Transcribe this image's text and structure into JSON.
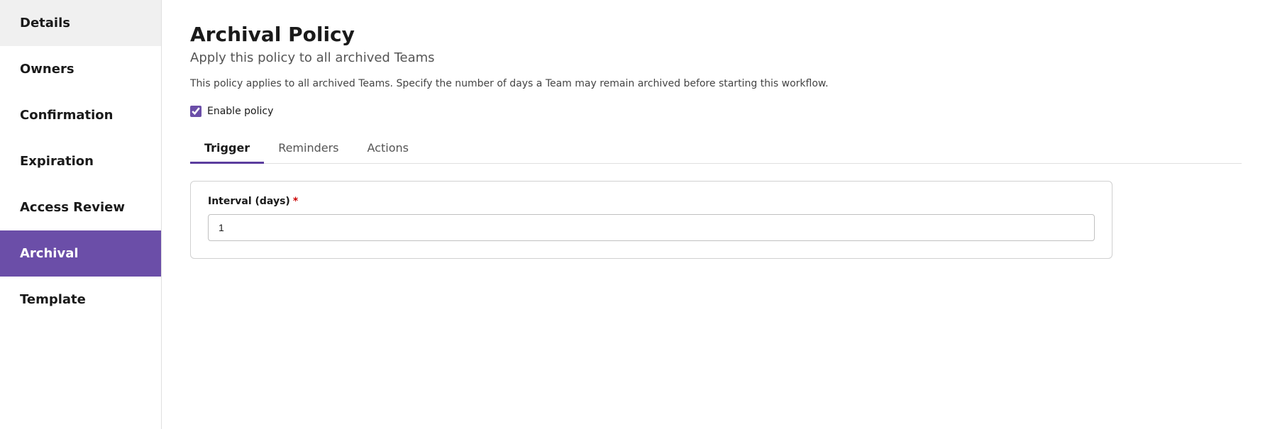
{
  "sidebar": {
    "items": [
      {
        "id": "details",
        "label": "Details",
        "active": false
      },
      {
        "id": "owners",
        "label": "Owners",
        "active": false
      },
      {
        "id": "confirmation",
        "label": "Confirmation",
        "active": false
      },
      {
        "id": "expiration",
        "label": "Expiration",
        "active": false
      },
      {
        "id": "access-review",
        "label": "Access Review",
        "active": false
      },
      {
        "id": "archival",
        "label": "Archival",
        "active": true
      },
      {
        "id": "template",
        "label": "Template",
        "active": false
      }
    ]
  },
  "main": {
    "title": "Archival Policy",
    "subtitle": "Apply this policy to all archived Teams",
    "description": "This policy applies to all archived Teams. Specify the number of days a Team may remain archived before starting this workflow.",
    "enable_policy_label": "Enable policy",
    "enable_policy_checked": true,
    "tabs": [
      {
        "id": "trigger",
        "label": "Trigger",
        "active": true
      },
      {
        "id": "reminders",
        "label": "Reminders",
        "active": false
      },
      {
        "id": "actions",
        "label": "Actions",
        "active": false
      }
    ],
    "interval": {
      "label": "Interval (days)",
      "required": true,
      "required_symbol": "*",
      "value": "1"
    }
  },
  "colors": {
    "sidebar_active_bg": "#6b4ea8",
    "tab_active_border": "#5b3d9e",
    "checkbox_accent": "#6b4ea8",
    "required_star": "#cc0000"
  }
}
